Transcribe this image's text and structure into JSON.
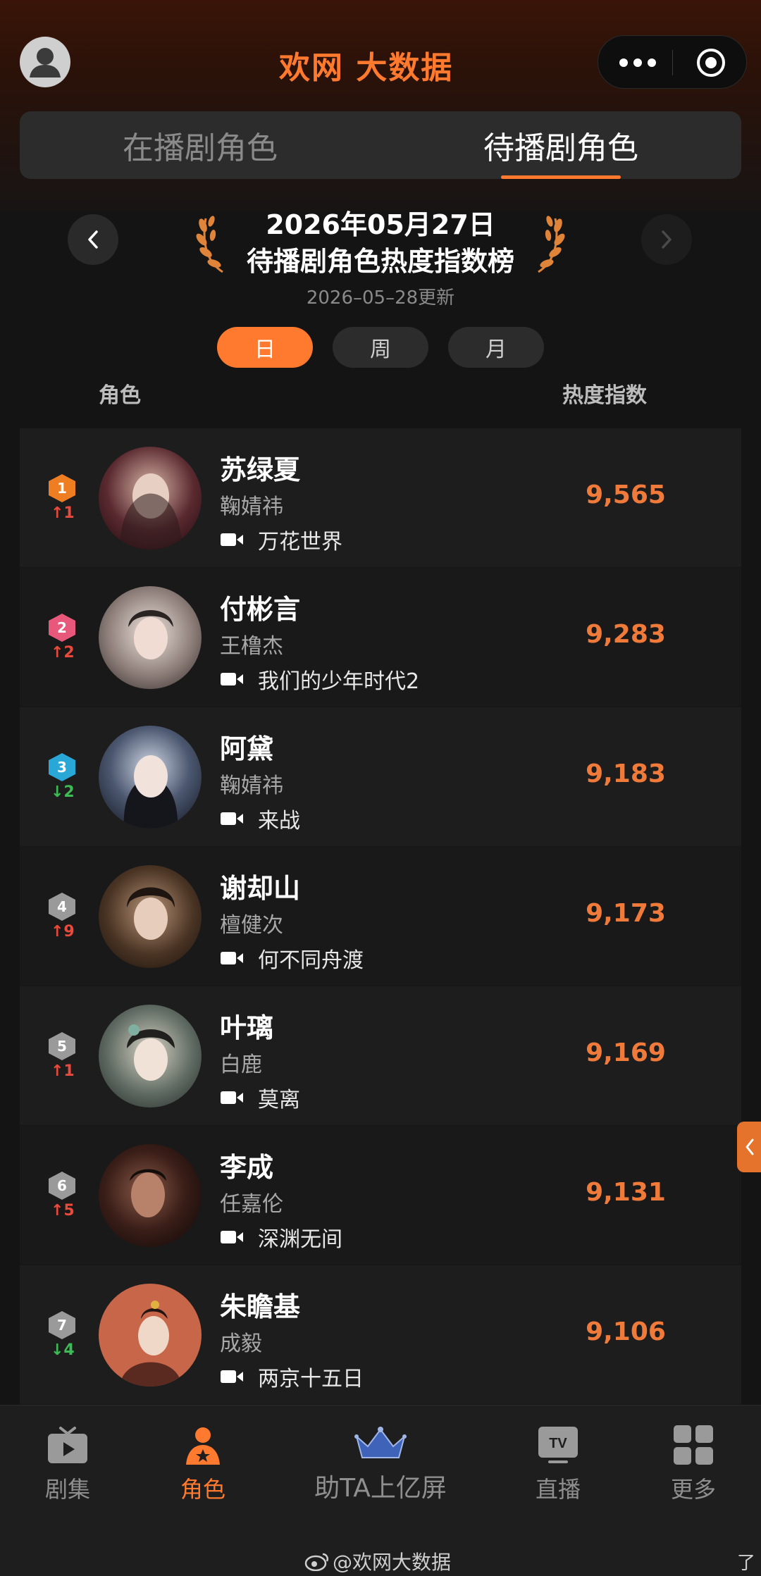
{
  "app": {
    "brand": "欢网 大数据"
  },
  "tabs": [
    {
      "label": "在播剧角色",
      "active": false
    },
    {
      "label": "待播剧角色",
      "active": true
    }
  ],
  "ranking": {
    "date": "2026年05月27日",
    "title": "待播剧角色热度指数榜",
    "updated": "2026–05–28更新"
  },
  "period": [
    {
      "label": "日",
      "active": true
    },
    {
      "label": "周",
      "active": false
    },
    {
      "label": "月",
      "active": false
    }
  ],
  "columns": {
    "role": "角色",
    "score": "热度指数"
  },
  "rows": [
    {
      "rank": "1",
      "trend": "↑1",
      "dir": "up",
      "role": "苏绿夏",
      "actor": "鞠婧祎",
      "drama": "万花世界",
      "score": "9,565",
      "badge_color": "#ef7d22"
    },
    {
      "rank": "2",
      "trend": "↑2",
      "dir": "up",
      "role": "付彬言",
      "actor": "王橹杰",
      "drama": "我们的少年时代2",
      "score": "9,283",
      "badge_color": "#e8587a"
    },
    {
      "rank": "3",
      "trend": "↓2",
      "dir": "down",
      "role": "阿黛",
      "actor": "鞠婧祎",
      "drama": "来战",
      "score": "9,183",
      "badge_color": "#29a8d8"
    },
    {
      "rank": "4",
      "trend": "↑9",
      "dir": "up",
      "role": "谢却山",
      "actor": "檀健次",
      "drama": "何不同舟渡",
      "score": "9,173",
      "badge_color": "#9a9a9a"
    },
    {
      "rank": "5",
      "trend": "↑1",
      "dir": "up",
      "role": "叶璃",
      "actor": "白鹿",
      "drama": "莫离",
      "score": "9,169",
      "badge_color": "#9a9a9a"
    },
    {
      "rank": "6",
      "trend": "↑5",
      "dir": "up",
      "role": "李成",
      "actor": "任嘉伦",
      "drama": "深渊无间",
      "score": "9,131",
      "badge_color": "#9a9a9a"
    },
    {
      "rank": "7",
      "trend": "↓4",
      "dir": "down",
      "role": "朱瞻基",
      "actor": "成毅",
      "drama": "两京十五日",
      "score": "9,106",
      "badge_color": "#9a9a9a"
    }
  ],
  "bottom_nav": {
    "series": "剧集",
    "roles": "角色",
    "boost": "助TA上亿屏",
    "live": "直播",
    "more": "更多"
  },
  "watermark": "@欢网大数据",
  "corner_char": "了"
}
